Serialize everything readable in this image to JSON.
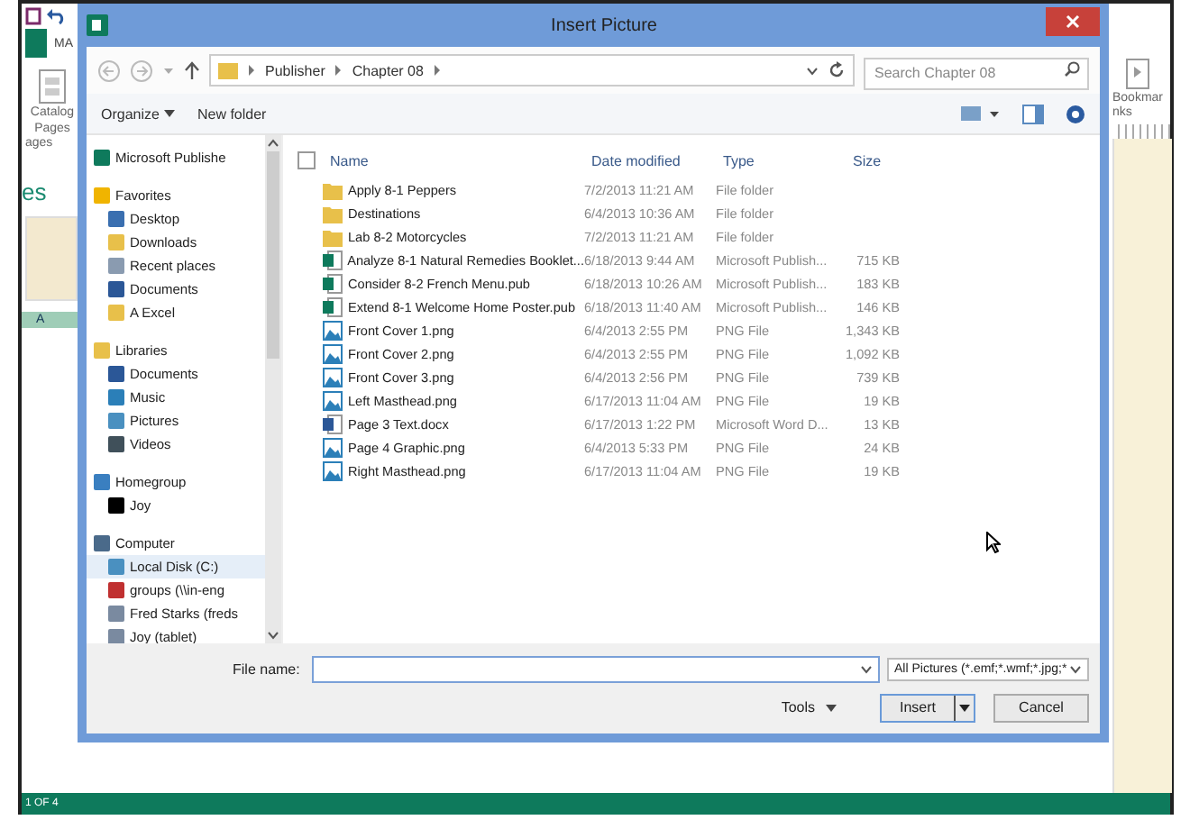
{
  "app": {
    "tab_label": "MA",
    "ribbon_left": "Catalog Pages",
    "group_left": "ages",
    "pane_heading": "es",
    "page_label": "A",
    "ribbon_right": "Bookmar",
    "group_right": "nks",
    "status": "1 OF 4"
  },
  "dialog": {
    "title": "Insert Picture",
    "breadcrumb": [
      "Publisher",
      "Chapter 08"
    ],
    "search": {
      "placeholder": "Search Chapter 08"
    },
    "toolbar": [
      "Organize",
      "New folder"
    ],
    "nav": [
      {
        "label": "Microsoft Publishe",
        "kind": "app"
      },
      {
        "label": "Favorites",
        "kind": "star",
        "children": [
          {
            "label": "Desktop",
            "kind": "desktop",
            "selected": false
          },
          {
            "label": "Downloads",
            "kind": "folder",
            "selected": false
          },
          {
            "label": "Recent places",
            "kind": "recent",
            "selected": false
          },
          {
            "label": "Documents",
            "kind": "doc",
            "selected": false
          },
          {
            "label": "A Excel",
            "kind": "folder",
            "selected": false
          }
        ]
      },
      {
        "label": "Libraries",
        "kind": "library",
        "children": [
          {
            "label": "Documents",
            "kind": "doc",
            "selected": false
          },
          {
            "label": "Music",
            "kind": "music",
            "selected": false
          },
          {
            "label": "Pictures",
            "kind": "picture",
            "selected": false
          },
          {
            "label": "Videos",
            "kind": "video",
            "selected": false
          }
        ]
      },
      {
        "label": "Homegroup",
        "kind": "homegroup",
        "children": [
          {
            "label": "Joy",
            "kind": "user",
            "selected": false
          }
        ]
      },
      {
        "label": "Computer",
        "kind": "computer",
        "children": [
          {
            "label": "Local Disk (C:)",
            "kind": "disk",
            "selected": true
          },
          {
            "label": "groups (\\\\in-eng",
            "kind": "netfail",
            "selected": false
          },
          {
            "label": "Fred Starks (freds",
            "kind": "net",
            "selected": false
          },
          {
            "label": "Joy (tablet)",
            "kind": "net",
            "selected": false
          }
        ]
      }
    ],
    "select_all_checked": false,
    "columns": [
      "Name",
      "Date modified",
      "Type",
      "Size"
    ],
    "files": [
      {
        "name": "Apply 8-1 Peppers",
        "date": "7/2/2013 11:21 AM",
        "type": "File folder",
        "kind": "folder"
      },
      {
        "name": "Destinations",
        "date": "6/4/2013 10:36 AM",
        "type": "File folder",
        "kind": "folder"
      },
      {
        "name": "Lab 8-2 Motorcycles",
        "date": "7/2/2013 11:21 AM",
        "type": "File folder",
        "kind": "folder"
      },
      {
        "name": "Analyze 8-1 Natural Remedies Booklet...",
        "date": "6/18/2013 9:44 AM",
        "type": "Microsoft Publish...",
        "size": "715 KB",
        "kind": "pub"
      },
      {
        "name": "Consider 8-2 French Menu.pub",
        "date": "6/18/2013 10:26 AM",
        "type": "Microsoft Publish...",
        "size": "183 KB",
        "kind": "pub"
      },
      {
        "name": "Extend 8-1 Welcome Home Poster.pub",
        "date": "6/18/2013 11:40 AM",
        "type": "Microsoft Publish...",
        "size": "146 KB",
        "kind": "pub"
      },
      {
        "name": "Front Cover 1.png",
        "date": "6/4/2013 2:55 PM",
        "type": "PNG File",
        "size": "1,343 KB",
        "kind": "png"
      },
      {
        "name": "Front Cover 2.png",
        "date": "6/4/2013 2:55 PM",
        "type": "PNG File",
        "size": "1,092 KB",
        "kind": "png"
      },
      {
        "name": "Front Cover 3.png",
        "date": "6/4/2013 2:56 PM",
        "type": "PNG File",
        "size": "739 KB",
        "kind": "png"
      },
      {
        "name": "Left Masthead.png",
        "date": "6/17/2013 11:04 AM",
        "type": "PNG File",
        "size": "19 KB",
        "kind": "png"
      },
      {
        "name": "Page 3 Text.docx",
        "date": "6/17/2013 1:22 PM",
        "type": "Microsoft Word D...",
        "size": "13 KB",
        "kind": "doc"
      },
      {
        "name": "Page 4 Graphic.png",
        "date": "6/4/2013 5:33 PM",
        "type": "PNG File",
        "size": "24 KB",
        "kind": "png"
      },
      {
        "name": "Right Masthead.png",
        "date": "6/17/2013 11:04 AM",
        "type": "PNG File",
        "size": "19 KB",
        "kind": "png"
      }
    ],
    "file_name_label": "File name:",
    "filter": "All Pictures (*.emf;*.wmf;*.jpg;*",
    "tools": "Tools",
    "insert": "Insert",
    "cancel": "Cancel"
  }
}
